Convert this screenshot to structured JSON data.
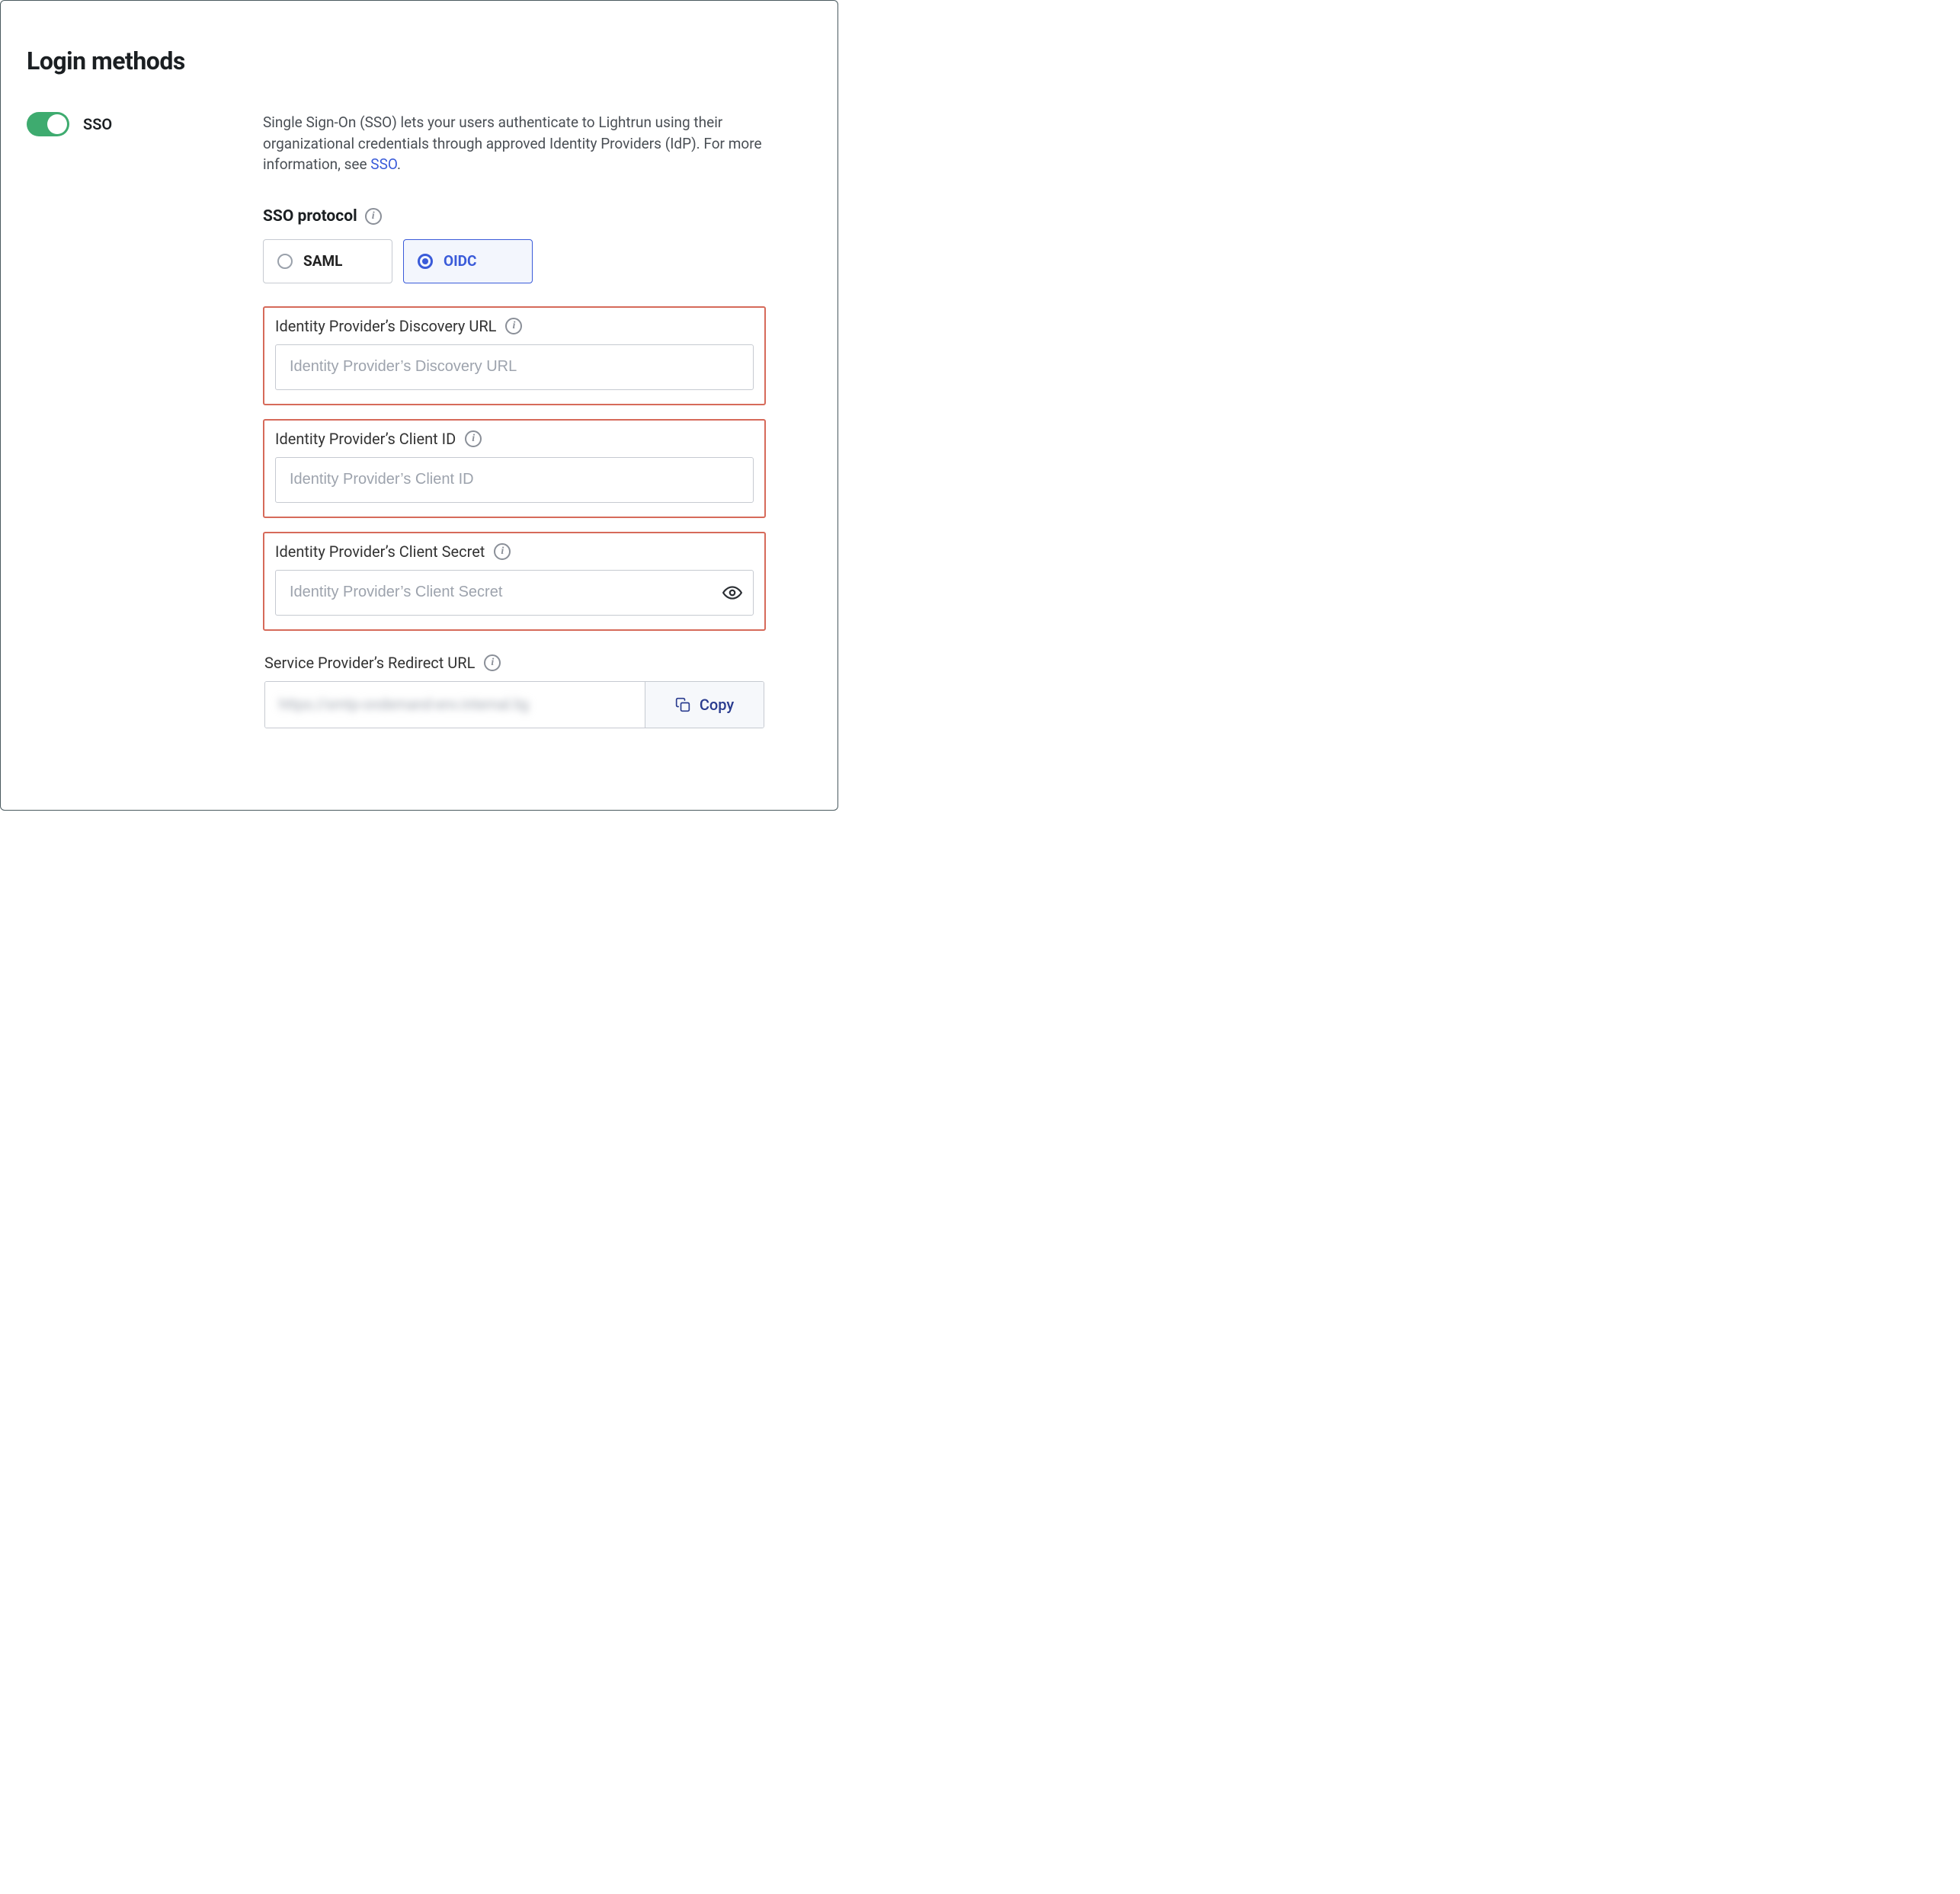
{
  "title": "Login methods",
  "sso": {
    "toggle_label": "SSO",
    "toggle_on": true,
    "description_pre": "Single Sign-On (SSO) lets your users authenticate to Lightrun using their organizational credentials through approved Identity Providers (IdP). For more information, see ",
    "description_link_text": "SSO",
    "description_post": ".",
    "protocol_label": "SSO protocol",
    "options": {
      "saml": "SAML",
      "oidc": "OIDC"
    },
    "selected": "oidc",
    "fields": {
      "discovery": {
        "label": "Identity Provider’s Discovery URL",
        "placeholder": "Identity Provider’s Discovery URL",
        "value": ""
      },
      "client_id": {
        "label": "Identity Provider’s Client ID",
        "placeholder": "Identity Provider’s Client ID",
        "value": ""
      },
      "client_secret": {
        "label": "Identity Provider’s Client Secret",
        "placeholder": "Identity Provider’s Client Secret",
        "value": ""
      },
      "redirect": {
        "label": "Service Provider’s Redirect URL",
        "value": "https://smtp-ondemand-env.internal.lig",
        "copy_label": "Copy"
      }
    }
  }
}
